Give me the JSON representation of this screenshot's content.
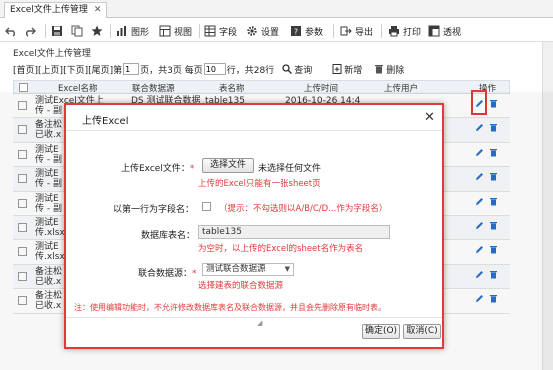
{
  "tab": {
    "title": "Excel文件上传管理",
    "close": "✕"
  },
  "toolbar": {
    "chart": "图形",
    "view": "视图",
    "fields": "字段",
    "settings": "设置",
    "params": "参数",
    "export": "导出",
    "print": "打印",
    "pivot": "透视"
  },
  "page": {
    "title": "Excel文件上传管理"
  },
  "pager": {
    "first": "[首页]",
    "prev": "[上页]",
    "next": "[下页]",
    "last": "[尾页]",
    "page_prefix": "第",
    "page_value": "1",
    "total_pages": "页，共3页 每页",
    "per_page_value": "10",
    "rows_text": "行，共28行",
    "query": "查询",
    "add": "新增",
    "delete": "删除"
  },
  "table": {
    "columns": [
      "Excel名称",
      "联合数据源",
      "表名称",
      "上传时间",
      "上传用户",
      "操作"
    ],
    "rows": [
      {
        "c1": "测试Excel文件上",
        "c1b": "传 - 副",
        "c2": "DS 测试联合数据",
        "c3": "table135",
        "c4": "2016-10-26 14:4"
      },
      {
        "c1": "备注松",
        "c1b": "已收.x"
      },
      {
        "c1": "测试E",
        "c1b": "传 - 副"
      },
      {
        "c1": "测试E",
        "c1b": "传 - 副"
      },
      {
        "c1": "测试E",
        "c1b": "传 - 副"
      },
      {
        "c1": "测试E",
        "c1b": "传.xlsx"
      },
      {
        "c1": "测试E",
        "c1b": "传.xlsx"
      },
      {
        "c1": "备注松",
        "c1b": "已收.x"
      },
      {
        "c1": "备注松",
        "c1b": "已收.x"
      }
    ]
  },
  "dialog": {
    "title": "上传Excel",
    "close": "✕",
    "file_label": "上传Excel文件：",
    "required_mark": "*",
    "choose_file_button": "选择文件",
    "no_file_text": "未选择任何文件",
    "file_hint": "上传的Excel只能有一张sheet页",
    "first_row_label": "以第一行为字段名：",
    "first_row_hint": "（提示：不勾选则以A/B/C/D...作为字段名）",
    "table_name_label": "数据库表名：",
    "table_name_value": "table135",
    "table_name_hint": "为空时，以上传的Excel的sheet名作为表名",
    "datasource_label": "联合数据源：",
    "datasource_value": "测试联合数据源",
    "datasource_hint": "选择建表的联合数据源",
    "note": "注：使用编辑功能时，不允许修改数据库表名及联合数据源，并且会先删除原有临时表。",
    "ok_button": "确定(O)",
    "cancel_button": "取消(C)"
  },
  "colors": {
    "accent_red": "#e03a3a",
    "action_blue": "#2a6fc9"
  }
}
